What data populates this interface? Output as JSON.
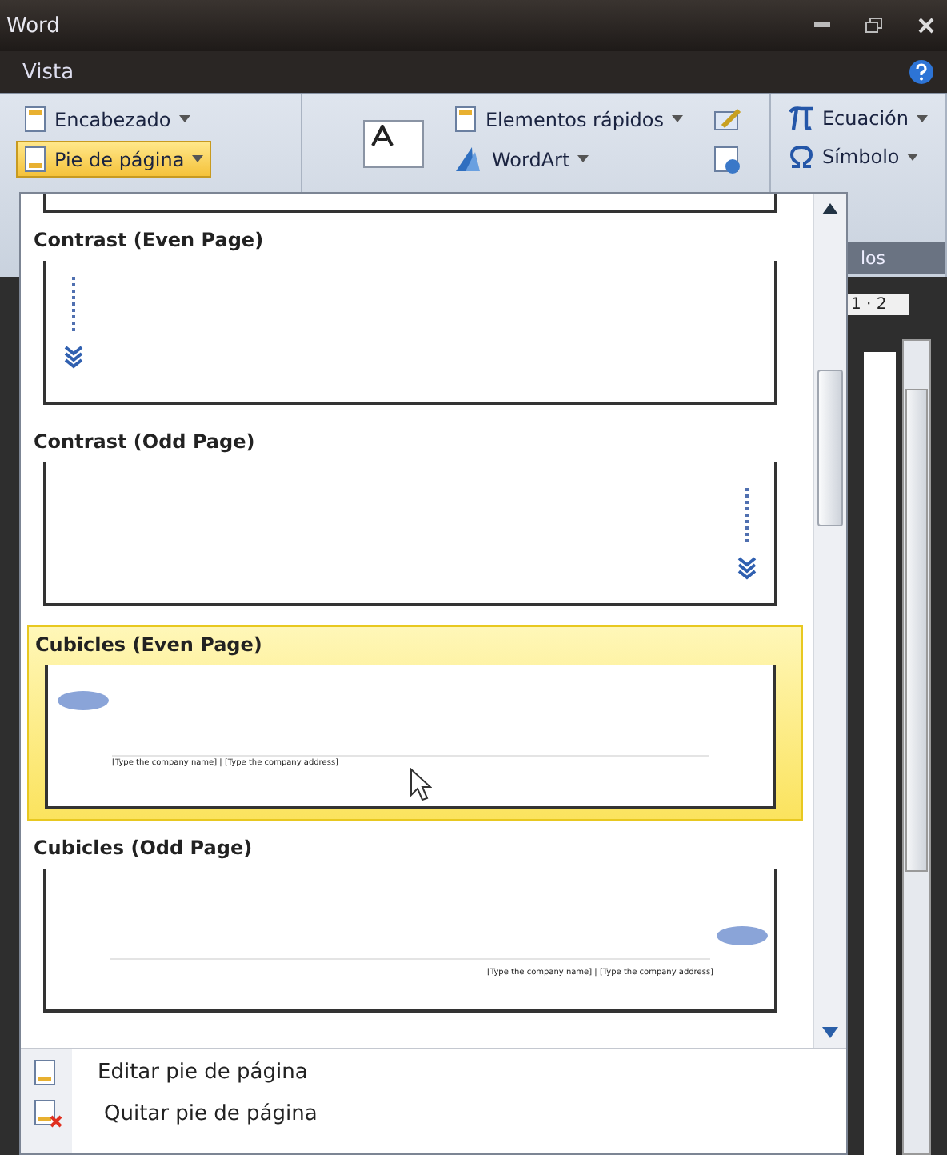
{
  "window": {
    "title": "Word"
  },
  "menu_bar": {
    "tabs": [
      {
        "label": "Vista",
        "selected": false
      }
    ]
  },
  "ribbon": {
    "groups": [
      {
        "buttons": [
          {
            "label": "Encabezado",
            "selected": false
          },
          {
            "label": "Pie de página",
            "selected": true
          }
        ]
      },
      {
        "buttons": [
          {
            "label": "Elementos rápidos",
            "selected": false
          },
          {
            "label": "WordArt",
            "selected": false
          }
        ]
      },
      {
        "buttons": [
          {
            "label": "Ecuación",
            "selected": false
          },
          {
            "label": "Símbolo",
            "selected": false
          }
        ],
        "caption": "los"
      }
    ]
  },
  "ruler": {
    "text": "1 · 2"
  },
  "gallery": {
    "items": [
      {
        "title": "Contrast (Even Page)",
        "kind": "contrast-left",
        "selected": false
      },
      {
        "title": "Contrast (Odd Page)",
        "kind": "contrast-right",
        "selected": false
      },
      {
        "title": "Cubicles (Even Page)",
        "kind": "cubicles-left",
        "selected": true,
        "preview_text": "[Type the company name] | [Type the company address]"
      },
      {
        "title": "Cubicles (Odd Page)",
        "kind": "cubicles-right",
        "selected": false,
        "preview_text": "[Type the company name] | [Type the company address]"
      }
    ]
  },
  "menu": {
    "items": [
      {
        "label": "Editar pie de página"
      },
      {
        "label": "Quitar pie de página"
      }
    ]
  }
}
